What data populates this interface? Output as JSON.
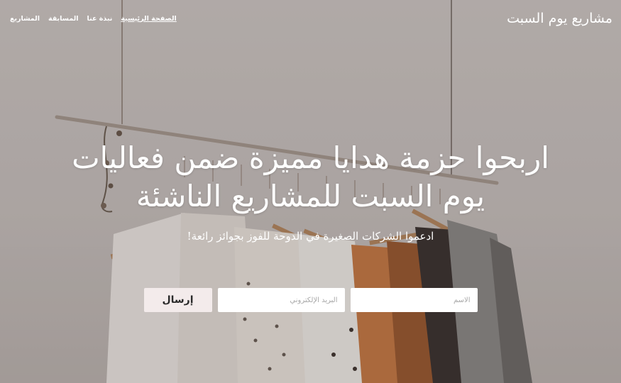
{
  "navbar": {
    "brand": "مشاريع يوم السبت",
    "links": [
      {
        "label": "الصفحة الرئيسية",
        "active": true
      },
      {
        "label": "نبذة عنا",
        "active": false
      },
      {
        "label": "المسابقة",
        "active": false
      },
      {
        "label": "المشاريع",
        "active": false
      }
    ]
  },
  "hero": {
    "title": "اربحوا حزمة هدايا مميزة  ضمن فعاليات يوم السبت للمشاريع الناشئة",
    "subtitle": "ادعموا الشركات الصغيرة في الدوحة للفوز بجوائز رائعة!"
  },
  "form": {
    "name_placeholder": "الاسم",
    "email_placeholder": "البريد الإلكتروني",
    "submit_label": "إرسال"
  },
  "colors": {
    "submit_bg": "#f3ebeb",
    "text": "#ffffff"
  }
}
